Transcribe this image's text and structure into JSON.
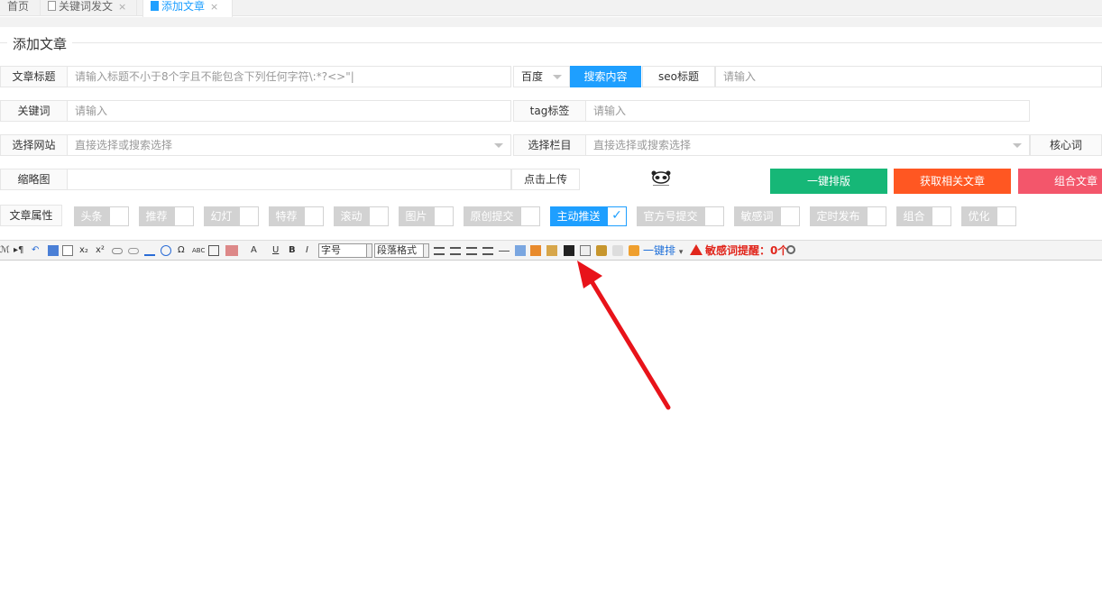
{
  "tabs": {
    "home": "首页",
    "keyword_post": "关键词发文",
    "add_article": "添加文章",
    "close": "×"
  },
  "form": {
    "legend": "添加文章",
    "title_label": "文章标题",
    "title_placeholder": "请输入标题不小于8个字且不能包含下列任何字符\\:*?<>\"|",
    "engine_value": "百度",
    "search_button": "搜索内容",
    "seo_title_label": "seo标题",
    "seo_title_placeholder": "请输入",
    "keyword_label": "关键词",
    "keyword_placeholder": "请输入",
    "tag_label": "tag标签",
    "tag_placeholder": "请输入",
    "site_label": "选择网站",
    "site_placeholder": "直接选择或搜索选择",
    "column_label": "选择栏目",
    "column_placeholder": "直接选择或搜索选择",
    "core_word_label": "核心词",
    "thumb_label": "缩略图",
    "upload_button": "点击上传",
    "format_button": "一键排版",
    "related_button": "获取相关文章",
    "combine_button": "组合文章",
    "attr_label": "文章属性"
  },
  "attributes": [
    {
      "label": "头条",
      "checked": false
    },
    {
      "label": "推荐",
      "checked": false
    },
    {
      "label": "幻灯",
      "checked": false
    },
    {
      "label": "特荐",
      "checked": false
    },
    {
      "label": "滚动",
      "checked": false
    },
    {
      "label": "图片",
      "checked": false
    },
    {
      "label": "原创提交",
      "checked": false
    },
    {
      "label": "主动推送",
      "checked": true
    },
    {
      "label": "官方号提交",
      "checked": false
    },
    {
      "label": "敏感词",
      "checked": false
    },
    {
      "label": "定时发布",
      "checked": false
    },
    {
      "label": "组合",
      "checked": false
    },
    {
      "label": "优化",
      "checked": false
    }
  ],
  "toolbar": {
    "font_size": "字号",
    "paragraph_format": "段落格式",
    "one_key": "一键排",
    "sensitive_warning": "敏感词提醒：0个",
    "symbols": [
      "ℳ",
      "▸¶",
      "↶",
      "x₂",
      "x²",
      "A",
      "U",
      "B",
      "I",
      "Ω",
      "ABC"
    ]
  },
  "colors": {
    "accent": "#1e9fff",
    "green": "#16b777",
    "orange": "#ff5722",
    "pink": "#f3566b",
    "annotation": "#e8131a"
  }
}
